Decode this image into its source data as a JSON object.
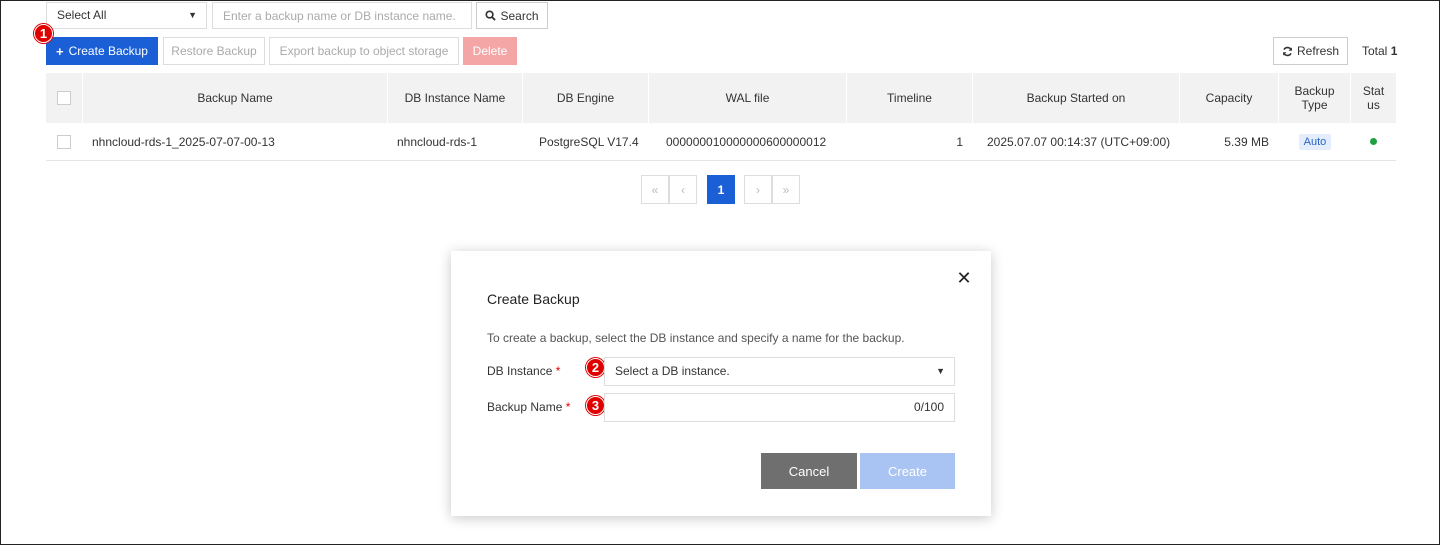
{
  "filter": {
    "select_value": "Select All",
    "search_placeholder": "Enter a backup name or DB instance name.",
    "search_button": "Search"
  },
  "toolbar": {
    "create_backup": "Create Backup",
    "restore_backup": "Restore Backup",
    "export_backup": "Export backup to object storage",
    "delete": "Delete",
    "refresh": "Refresh",
    "total_label": "Total",
    "total_count": "1"
  },
  "markers": {
    "m1": "1",
    "m2": "2",
    "m3": "3"
  },
  "table": {
    "headers": {
      "backup_name": "Backup Name",
      "db_instance_name": "DB Instance Name",
      "db_engine": "DB Engine",
      "wal_file": "WAL file",
      "timeline": "Timeline",
      "started_on": "Backup Started on",
      "capacity": "Capacity",
      "backup_type": "Backup Type",
      "status": "Stat us"
    },
    "rows": [
      {
        "backup_name": "nhncloud-rds-1_2025-07-07-00-13",
        "db_instance_name": "nhncloud-rds-1",
        "db_engine": "PostgreSQL V17.4",
        "wal_file": "000000010000000600000012",
        "timeline": "1",
        "started_on": "2025.07.07 00:14:37 (UTC+09:00)",
        "capacity": "5.39 MB",
        "backup_type": "Auto",
        "status_color": "#20a040"
      }
    ]
  },
  "pagination": {
    "first": "«",
    "prev": "‹",
    "current": "1",
    "next": "›",
    "last": "»"
  },
  "modal": {
    "title": "Create Backup",
    "close": "✕",
    "description": "To create a backup, select the DB instance and specify a name for the backup.",
    "db_instance_label": "DB Instance",
    "db_instance_placeholder": "Select a DB instance.",
    "backup_name_label": "Backup Name",
    "backup_name_counter": "0/100",
    "required_mark": "*",
    "cancel": "Cancel",
    "create": "Create"
  },
  "colors": {
    "primary": "#1a5fd6",
    "danger_disabled": "#f4a6a6",
    "marker": "#e00000"
  }
}
